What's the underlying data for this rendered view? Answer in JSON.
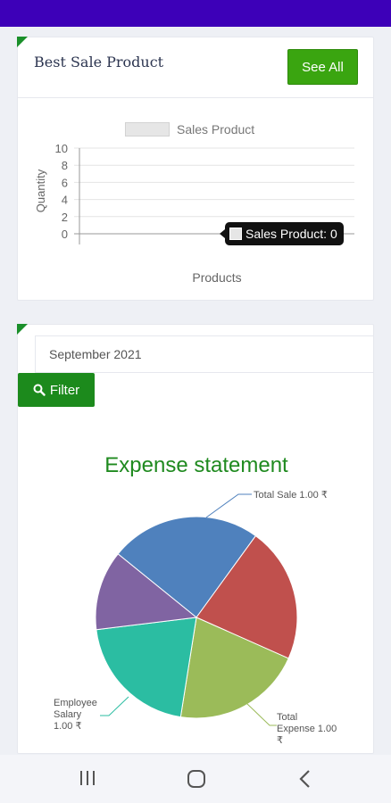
{
  "best_sale": {
    "title": "Best Sale Product",
    "see_all_label": "See All"
  },
  "chart_data": [
    {
      "type": "bar",
      "title": "",
      "legend": [
        "Sales Product"
      ],
      "legend_position": "top",
      "xlabel": "Products",
      "ylabel": "Quantity",
      "ylim": [
        0,
        10
      ],
      "yticks": [
        "10",
        "8",
        "6",
        "4",
        "2",
        "0"
      ],
      "grid": true,
      "series": [
        {
          "name": "Sales Product",
          "values": [
            0
          ]
        }
      ],
      "tooltip": "Sales Product: 0"
    },
    {
      "type": "pie",
      "title": "Expense statement",
      "slice_colors": [
        "#4f81bd",
        "#c0504d",
        "#9bbb59",
        "#2bbda2",
        "#8064a2"
      ],
      "slices": [
        {
          "label": "Total Sale 1.00 ₹",
          "value": 1
        },
        {
          "label": "Total Expense 1.00 ₹",
          "value": 1
        },
        {
          "label": "Employee Salary 1.00 ₹",
          "value": 1
        }
      ]
    }
  ],
  "filter": {
    "month": "September 2021",
    "button_label": "Filter"
  },
  "colors": {
    "status_bar": "#3d00b8",
    "accent_green": "#3aa510",
    "filter_green": "#1c8a1c"
  },
  "icons": {
    "filter": "search-icon",
    "nav_recents": "recents-icon",
    "nav_home": "home-icon",
    "nav_back": "back-icon"
  }
}
